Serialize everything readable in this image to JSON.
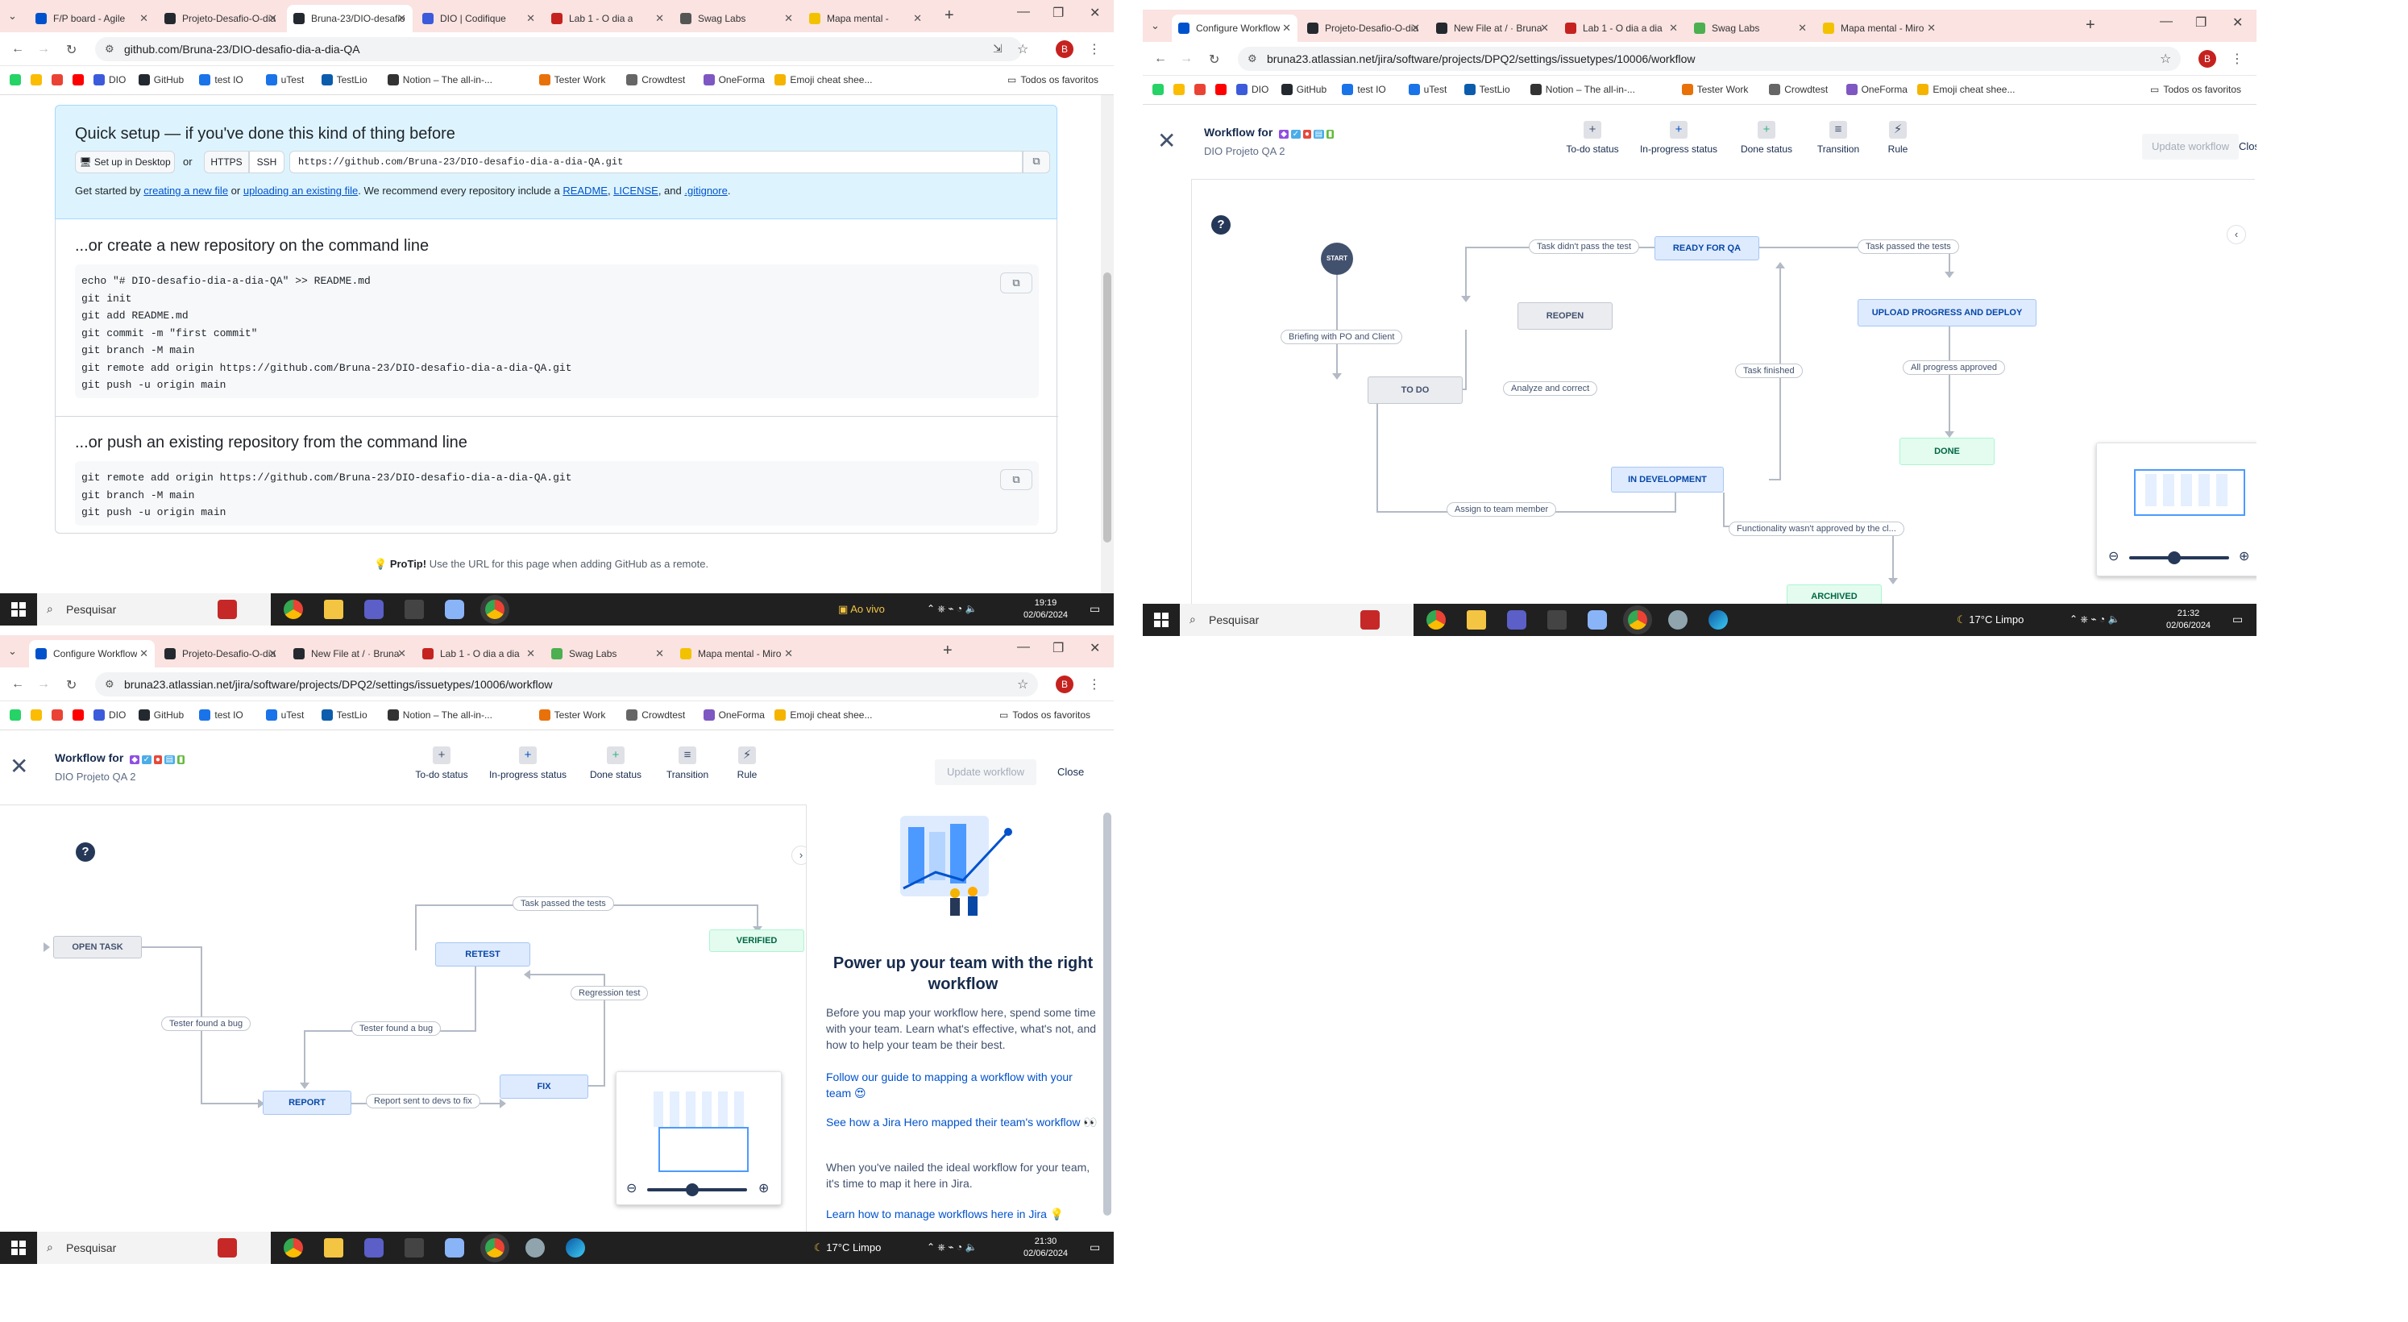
{
  "browser_tl": {
    "tabs": [
      {
        "label": "F/P board - Agile",
        "color": "#0052cc"
      },
      {
        "label": "Projeto-Desafio-O-dia",
        "color": "#24292f"
      },
      {
        "label": "Bruna-23/DIO-desafio",
        "color": "#24292f"
      },
      {
        "label": "DIO | Codifique",
        "color": "#3b5bdb"
      },
      {
        "label": "Lab 1 - O dia a",
        "color": "#c5221f"
      },
      {
        "label": "Swag Labs",
        "color": "#555555"
      },
      {
        "label": "Mapa mental -",
        "color": "#f2c200"
      }
    ],
    "url": "github.com/Bruna-23/DIO-desafio-dia-a-dia-QA",
    "avatar": "B"
  },
  "bookmarks": [
    {
      "label": "",
      "color": "#25d366"
    },
    {
      "label": "",
      "color": "#fbbc04"
    },
    {
      "label": "",
      "color": "#ea4335"
    },
    {
      "label": "",
      "color": "#ff0000"
    },
    {
      "label": "DIO",
      "color": "#3b5bdb"
    },
    {
      "label": "GitHub",
      "color": "#24292f"
    },
    {
      "label": "test IO",
      "color": "#1a73e8"
    },
    {
      "label": "uTest",
      "color": "#1a73e8"
    },
    {
      "label": "TestLio",
      "color": "#0b5cad"
    },
    {
      "label": "Notion – The all-in-...",
      "color": "#333333"
    },
    {
      "label": "Tester Work",
      "color": "#e8710a"
    },
    {
      "label": "Crowdtest",
      "color": "#666666"
    },
    {
      "label": "OneForma",
      "color": "#7e57c2"
    },
    {
      "label": "Emoji cheat shee...",
      "color": "#f4b400"
    }
  ],
  "bookmarks_folder": "Todos os favoritos",
  "github": {
    "quick_title": "Quick setup — if you've done this kind of thing before",
    "setup_desktop": "Set up in Desktop",
    "or": "or",
    "https": "HTTPS",
    "ssh": "SSH",
    "clone_url": "https://github.com/Bruna-23/DIO-desafio-dia-a-dia-QA.git",
    "started_1": "Get started by ",
    "started_link1": "creating a new file",
    "started_2": " or ",
    "started_link2": "uploading an existing file",
    "started_3": ". We recommend every repository include a ",
    "started_link3": "README",
    "started_4": ", ",
    "started_link4": "LICENSE",
    "started_5": ", and ",
    "started_link5": ".gitignore",
    "started_6": ".",
    "create_title": "...or create a new repository on the command line",
    "create_cmds": [
      "echo \"# DIO-desafio-dia-a-dia-QA\" >> README.md",
      "git init",
      "git add README.md",
      "git commit -m \"first commit\"",
      "git branch -M main",
      "git remote add origin https://github.com/Bruna-23/DIO-desafio-dia-a-dia-QA.git",
      "git push -u origin main"
    ],
    "push_title": "...or push an existing repository from the command line",
    "push_cmds": [
      "git remote add origin https://github.com/Bruna-23/DIO-desafio-dia-a-dia-QA.git",
      "git branch -M main",
      "git push -u origin main"
    ],
    "protip_bold": "ProTip!",
    "protip_text": " Use the URL for this page when adding GitHub as a remote."
  },
  "taskbar_tl": {
    "search": "Pesquisar",
    "live": "Ao vivo",
    "time": "19:19",
    "date": "02/06/2024"
  },
  "browser_tr": {
    "tabs": [
      {
        "label": "Configure Workflow",
        "color": "#0052cc"
      },
      {
        "label": "Projeto-Desafio-O-dia",
        "color": "#24292f"
      },
      {
        "label": "New File at / · Bruna",
        "color": "#24292f"
      },
      {
        "label": "Lab 1 - O dia a dia",
        "color": "#c5221f"
      },
      {
        "label": "Swag Labs",
        "color": "#4caf50"
      },
      {
        "label": "Mapa mental - Miro",
        "color": "#f2c200"
      }
    ],
    "url": "bruna23.atlassian.net/jira/software/projects/DPQ2/settings/issuetypes/10006/workflow",
    "avatar": "B"
  },
  "jira": {
    "workflow_for": "Workflow for",
    "project": "DIO Projeto QA 2",
    "tools": [
      {
        "label": "To-do status",
        "icon": "+"
      },
      {
        "label": "In-progress status",
        "icon": "+"
      },
      {
        "label": "Done status",
        "icon": "+"
      },
      {
        "label": "Transition",
        "icon": "≡"
      },
      {
        "label": "Rule",
        "icon": "⚡"
      }
    ],
    "update": "Update workflow",
    "close": "Close",
    "help": "?"
  },
  "wf1": {
    "start": "START",
    "nodes": {
      "ready": "READY FOR QA",
      "reopen": "REOPEN",
      "upload": "UPLOAD PROGRESS AND DEPLOY",
      "todo": "TO DO",
      "done": "DONE",
      "indev": "IN DEVELOPMENT",
      "archived": "ARCHIVED"
    },
    "edges": {
      "didnt": "Task didn't pass the test",
      "passed": "Task passed the tests",
      "briefing": "Briefing with PO and Client",
      "analyze": "Analyze and correct",
      "finished": "Task finished",
      "approved": "All progress approved",
      "assign": "Assign to team member",
      "notapproved": "Functionality wasn't approved by the cl..."
    }
  },
  "taskbar_tr": {
    "search": "Pesquisar",
    "weather": "17°C  Limpo",
    "time": "21:32",
    "date": "02/06/2024"
  },
  "browser_bl": {
    "tabs": [
      {
        "label": "Configure Workflow",
        "color": "#0052cc"
      },
      {
        "label": "Projeto-Desafio-O-dia",
        "color": "#24292f"
      },
      {
        "label": "New File at / · Bruna",
        "color": "#24292f"
      },
      {
        "label": "Lab 1 - O dia a dia",
        "color": "#c5221f"
      },
      {
        "label": "Swag Labs",
        "color": "#4caf50"
      },
      {
        "label": "Mapa mental - Miro",
        "color": "#f2c200"
      }
    ],
    "url": "bruna23.atlassian.net/jira/software/projects/DPQ2/settings/issuetypes/10006/workflow",
    "avatar": "B"
  },
  "wf2": {
    "nodes": {
      "open": "OPEN TASK",
      "retest": "RETEST",
      "verified": "VERIFIED",
      "report": "REPORT",
      "fix": "FIX"
    },
    "edges": {
      "passed": "Task passed the tests",
      "regression": "Regression test",
      "bug1": "Tester found a bug",
      "bug2": "Tester found a bug",
      "sent": "Report sent to devs to fix"
    }
  },
  "panel": {
    "title": "Power up your team with the right workflow",
    "p1": "Before you map your workflow here, spend some time with your team. Learn what's effective, what's not, and how to help your team be their best.",
    "link1": "Follow our guide to mapping a workflow with your team 😍",
    "link2": "See how a Jira Hero mapped their team's workflow 👀",
    "p2": "When you've nailed the ideal workflow for your team, it's time to map it here in Jira.",
    "link3": "Learn how to manage workflows here in Jira 💡"
  },
  "taskbar_bl": {
    "search": "Pesquisar",
    "weather": "17°C  Limpo",
    "time": "21:30",
    "date": "02/06/2024"
  }
}
